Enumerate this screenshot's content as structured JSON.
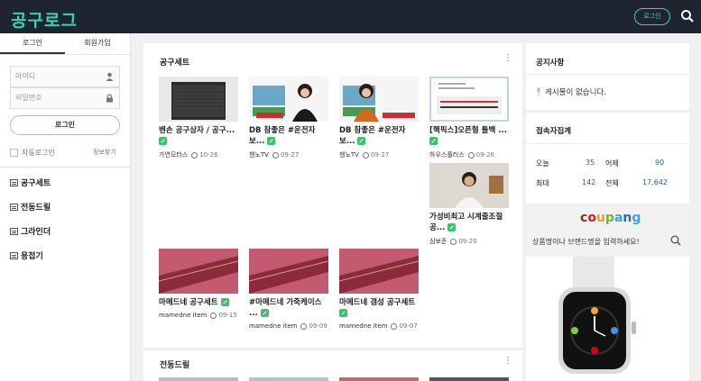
{
  "header": {
    "logo": "공구로그",
    "login_label": "로그인"
  },
  "sidebar": {
    "tabs": [
      "로그인",
      "회원가입"
    ],
    "id_placeholder": "아이디",
    "pw_placeholder": "비밀번호",
    "login_button": "로그인",
    "auto_login": "자동로그인",
    "find_info": "정보찾기",
    "menu": [
      "공구세트",
      "전동드릴",
      "그라인더",
      "용접기"
    ]
  },
  "sections": [
    {
      "title": "공구세트",
      "cards": [
        {
          "title": "벤손 공구상자 / 공구...",
          "author": "가연모터스",
          "date": "10-26"
        },
        {
          "title": "DB 참좋은 #운전자 보...",
          "author": "첸노TV",
          "date": "09-27"
        },
        {
          "title": "DB 참좋은 #운전자 보...",
          "author": "첸노TV",
          "date": "09-27"
        },
        {
          "title": "[핵픽스]오픈형 툴백 ...",
          "author": "하우스플러스",
          "date": "09-26"
        },
        {
          "title": "가성비최고 시계줄조절공...",
          "author": "심보준",
          "date": "09-20"
        },
        {
          "title": "마메드네 공구세트",
          "author": "mamedne item",
          "date": "09-15"
        },
        {
          "title": "#마메드네 가죽케이스 ...",
          "author": "mamedne item",
          "date": "09-09"
        },
        {
          "title": "마메드네 갬성 공구세트",
          "author": "mamedne item",
          "date": "09-07"
        }
      ]
    },
    {
      "title": "전동드릴"
    }
  ],
  "notice": {
    "title": "공지사항",
    "empty": "게시물이 없습니다."
  },
  "visitors": {
    "title": "접속자집계",
    "today_label": "오늘",
    "today": "35",
    "yesterday_label": "어제",
    "yesterday": "90",
    "max_label": "최대",
    "max": "142",
    "total_label": "전체",
    "total": "17,642"
  },
  "coupang": {
    "logo": "coupang",
    "placeholder": "상품명이나 브랜드명을 입력하세요!"
  },
  "colors": {
    "accent": "#3fd0b4",
    "topbar": "#1f2530",
    "link_green": "#3fbf6f",
    "stat_blue": "#2a5db0"
  }
}
